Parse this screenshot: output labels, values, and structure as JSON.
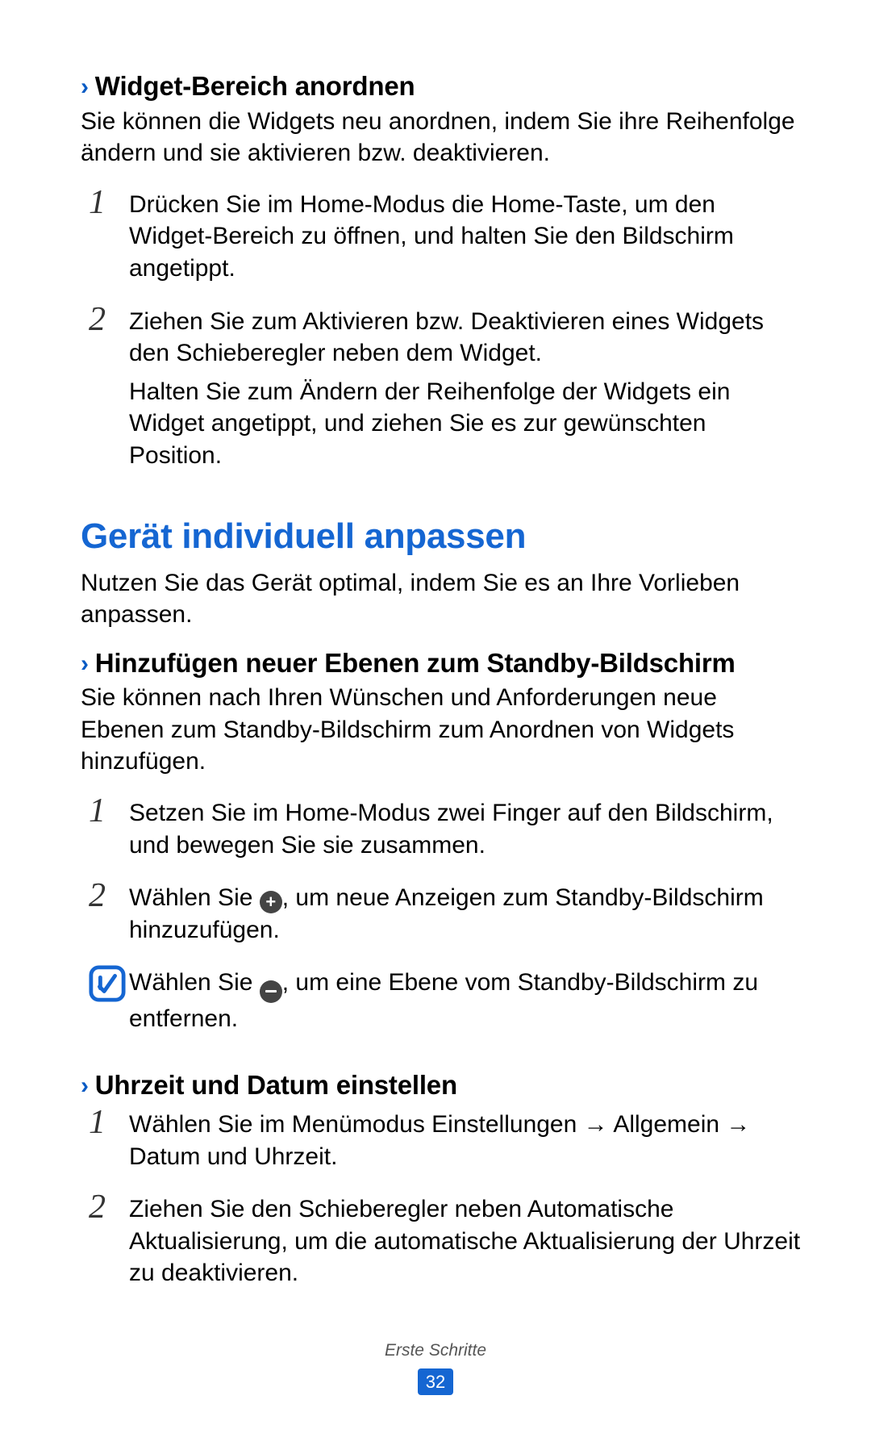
{
  "section1": {
    "title": "Widget-Bereich anordnen",
    "intro": "Sie können die Widgets neu anordnen, indem Sie ihre Reihenfolge ändern und sie aktivieren bzw. deaktivieren.",
    "steps": [
      {
        "num": "1",
        "p1": "Drücken Sie im Home-Modus die Home-Taste, um den Widget-Bereich zu öffnen, und halten Sie den Bildschirm angetippt."
      },
      {
        "num": "2",
        "p1": "Ziehen Sie zum Aktivieren bzw. Deaktivieren eines Widgets den Schieberegler neben dem Widget.",
        "p2": "Halten Sie zum Ändern der Reihenfolge der Widgets ein Widget angetippt, und ziehen Sie es zur gewünschten Position."
      }
    ]
  },
  "main_heading": "Gerät individuell anpassen",
  "main_intro": "Nutzen Sie das Gerät optimal, indem Sie es an Ihre Vorlieben anpassen.",
  "section2": {
    "title": "Hinzufügen neuer Ebenen zum Standby-Bildschirm",
    "intro": "Sie können nach Ihren Wünschen und Anforderungen neue Ebenen zum Standby-Bildschirm zum Anordnen von Widgets hinzufügen.",
    "steps": [
      {
        "num": "1",
        "p1": "Setzen Sie im Home-Modus zwei Finger auf den Bildschirm, und bewegen Sie sie zusammen."
      },
      {
        "num": "2",
        "pre": "Wählen Sie ",
        "post": ", um neue Anzeigen zum Standby-Bildschirm hinzuzufügen."
      }
    ],
    "note_pre": "Wählen Sie ",
    "note_post": ", um eine Ebene vom Standby-Bildschirm zu entfernen."
  },
  "section3": {
    "title": "Uhrzeit und Datum einstellen",
    "steps": [
      {
        "num": "1",
        "pre": "Wählen Sie im Menümodus ",
        "b1": "Einstellungen",
        "arrow1": " → ",
        "b2": "Allgemein",
        "arrow2": " → ",
        "b3": "Datum und Uhrzeit",
        "end": "."
      },
      {
        "num": "2",
        "pre": "Ziehen Sie den Schieberegler neben ",
        "b1": "Automatische Aktualisierung",
        "post": ", um die automatische Aktualisierung der Uhrzeit zu deaktivieren."
      }
    ]
  },
  "footer": {
    "section_label": "Erste Schritte",
    "page_num": "32"
  }
}
